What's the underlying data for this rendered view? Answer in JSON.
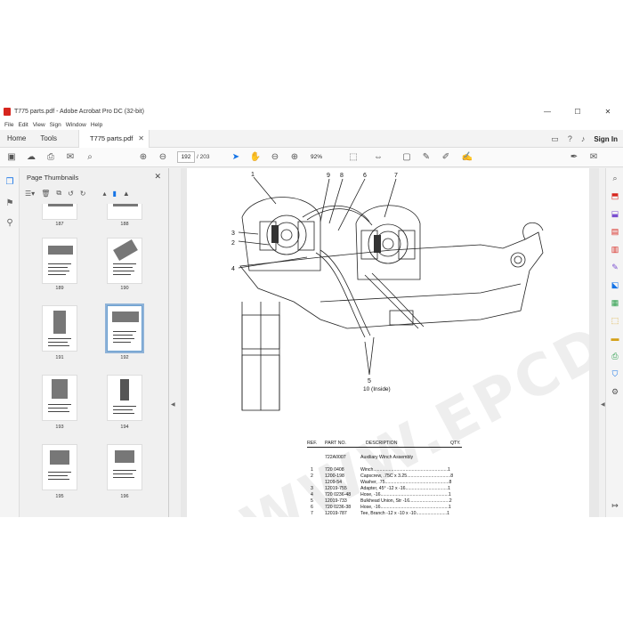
{
  "window": {
    "title": "T775 parts.pdf - Adobe Acrobat Pro DC (32-bit)",
    "controls": [
      "—",
      "☐",
      "✕"
    ]
  },
  "menu": [
    "File",
    "Edit",
    "View",
    "Sign",
    "Window",
    "Help"
  ],
  "tabs": {
    "home": "Home",
    "tools": "Tools",
    "document": "T775 parts.pdf",
    "sign_in": "Sign In"
  },
  "toolbar": {
    "page_current": "192",
    "page_sep": "/",
    "page_total": "203",
    "zoom": "92%"
  },
  "thumbnails_panel": {
    "title": "Page Thumbnails",
    "pages": [
      "187",
      "188",
      "189",
      "190",
      "191",
      "192",
      "193",
      "194",
      "195",
      "196"
    ],
    "selected": "192"
  },
  "diagram": {
    "callouts": [
      "1",
      "9",
      "8",
      "6",
      "7",
      "3",
      "2",
      "4",
      "5",
      "10 (Inside)"
    ]
  },
  "parts_list": {
    "headers": {
      "ref": "REF.",
      "part": "PART NO.",
      "desc": "DESCRIPTION",
      "qty": "QTY."
    },
    "assembly": {
      "part": "722A0007",
      "desc": "Auxiliary Winch Assembly"
    },
    "rows": [
      {
        "ref": "1",
        "part": "720 0408",
        "desc": "Winch..........................................................1"
      },
      {
        "ref": "2",
        "part": "1200-198",
        "desc": "Capscrew, .75C x 3.25..................................8"
      },
      {
        "ref": "",
        "part": "1209-54",
        "desc": "Washer, .75..................................................8"
      },
      {
        "ref": "3",
        "part": "12019-755",
        "desc": "Adapter, 45° -12 x -16.................................1"
      },
      {
        "ref": "4",
        "part": "720 0236-48",
        "desc": "Hose, -16.....................................................1"
      },
      {
        "ref": "5",
        "part": "12019-733",
        "desc": "Bulkhead Union, Str -16...............................2"
      },
      {
        "ref": "6",
        "part": "720 0236-38",
        "desc": "Hose, -16.....................................................1"
      },
      {
        "ref": "7",
        "part": "12019-787",
        "desc": "Tee, Branch -12 x -10 x -10........................1"
      }
    ]
  },
  "watermark": "WWW.EPCDEPO.COM",
  "colors": {
    "accent_blue": "#1473e6",
    "pdf_red": "#d7261e"
  }
}
